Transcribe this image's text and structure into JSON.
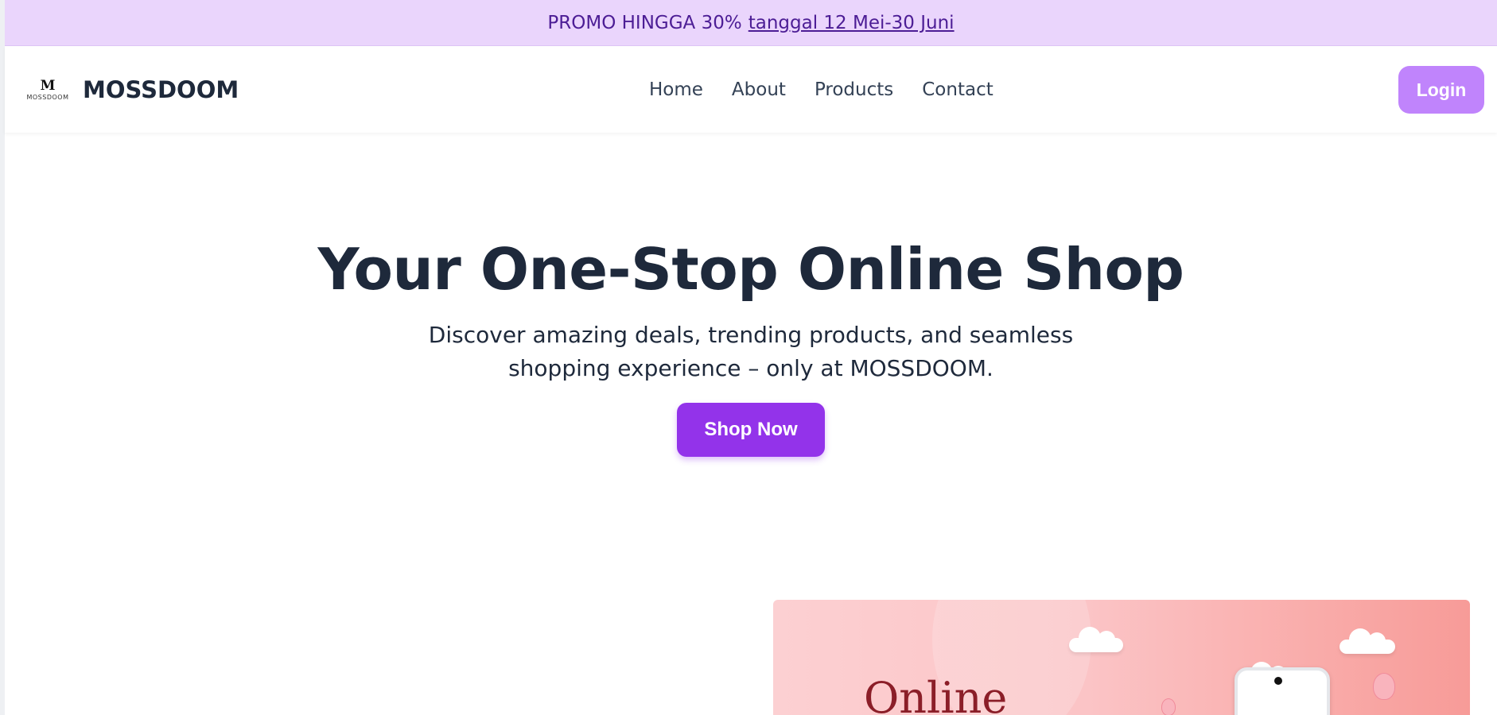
{
  "promo": {
    "text": "PROMO HINGGA 30%",
    "link": "tanggal 12 Mei-30 Juni"
  },
  "brand": {
    "logo_mark": "M",
    "logo_word": "MOSSDOOM",
    "name": "MOSSDOOM"
  },
  "nav": {
    "items": [
      {
        "label": "Home"
      },
      {
        "label": "About"
      },
      {
        "label": "Products"
      },
      {
        "label": "Contact"
      }
    ],
    "login_label": "Login"
  },
  "hero": {
    "title": "Your One-Stop Online Shop",
    "subtitle": "Discover amazing deals, trending products, and seamless shopping experience – only at MOSSDOOM.",
    "cta_label": "Shop Now"
  },
  "banner": {
    "text": "Online"
  },
  "colors": {
    "promo_bg": "#ead5fc",
    "accent": "#9333ea",
    "login_bg": "#c084fc",
    "text_dark": "#1e293b"
  }
}
